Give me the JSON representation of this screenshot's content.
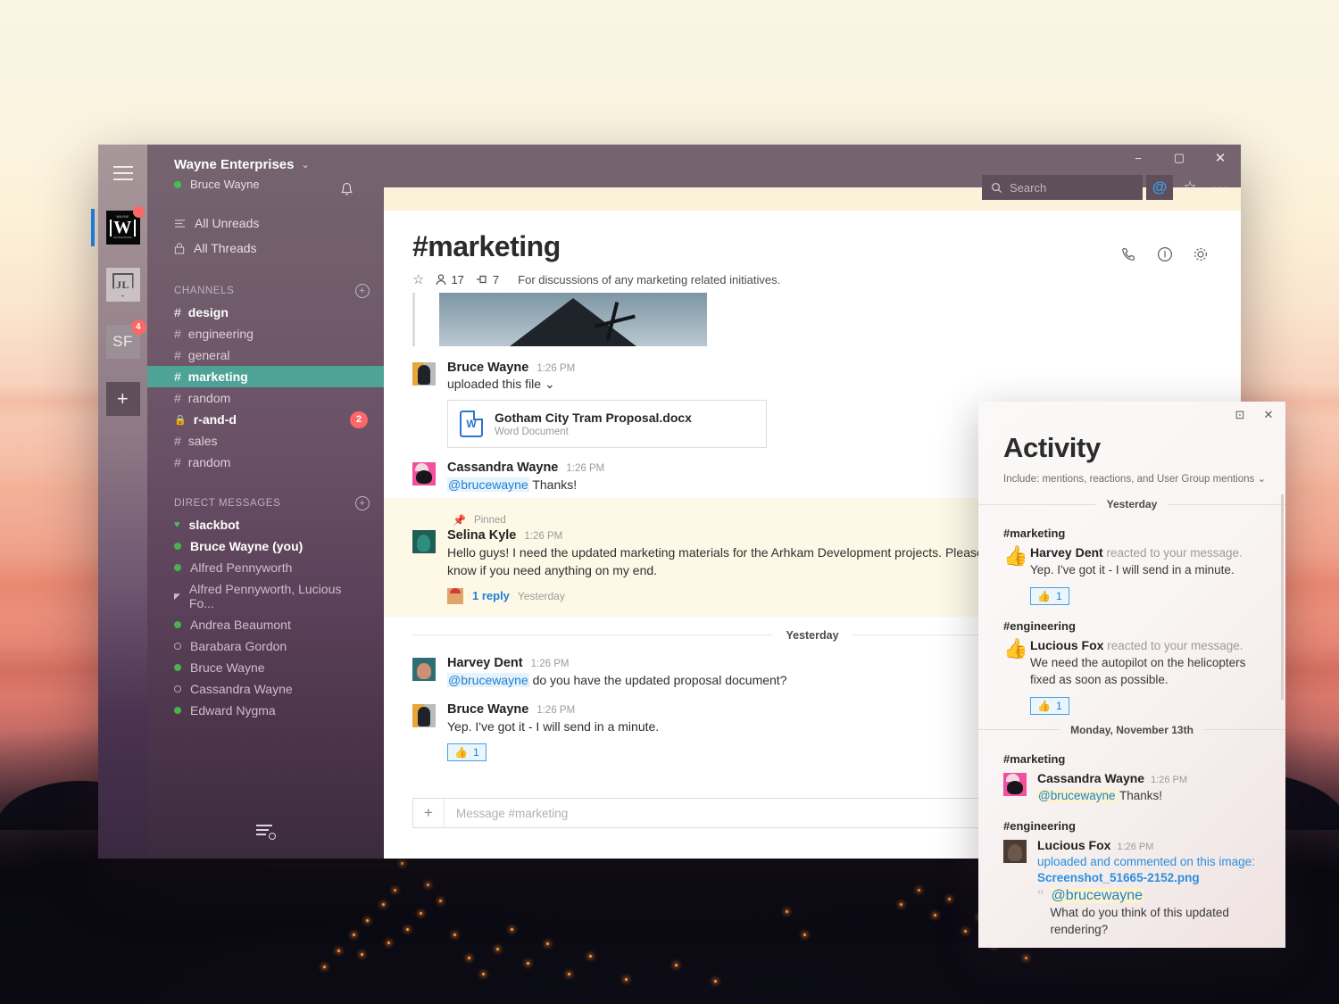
{
  "window": {
    "minimize": "−",
    "maximize": "▢",
    "close": "✕"
  },
  "rail": {
    "hamburger_icon": "hamburger-icon",
    "apps": [
      {
        "name": "Wayne Enterprises",
        "initials": "W",
        "logo_top": "WAYNE",
        "logo_bottom": "ENTERPRISES",
        "badge": "",
        "active": true
      },
      {
        "name": "Justice League",
        "initials": "JL",
        "badge": ""
      },
      {
        "name": "SF",
        "initials": "SF",
        "badge": "4"
      }
    ],
    "add_workspace_label": "+"
  },
  "topbar": {
    "search_placeholder": "Search",
    "search_value": "",
    "mentions_label": "@",
    "star_label": "☆",
    "more_label": "···"
  },
  "sidebar": {
    "team_name": "Wayne Enterprises",
    "team_chevron": "⌄",
    "user_name": "Bruce Wayne",
    "notifications_icon": "bell-icon",
    "nav": [
      {
        "label": "All Unreads",
        "icon": "unreads-icon"
      },
      {
        "label": "All Threads",
        "icon": "threads-icon"
      }
    ],
    "channels_header": "CHANNELS",
    "channels_add": "+",
    "channels": [
      {
        "name": "design",
        "prefix": "#",
        "bold": true,
        "active": false,
        "badge": ""
      },
      {
        "name": "engineering",
        "prefix": "#",
        "bold": false,
        "active": false,
        "badge": ""
      },
      {
        "name": "general",
        "prefix": "#",
        "bold": false,
        "active": false,
        "badge": ""
      },
      {
        "name": "marketing",
        "prefix": "#",
        "bold": true,
        "active": true,
        "badge": ""
      },
      {
        "name": "random",
        "prefix": "#",
        "bold": false,
        "active": false,
        "badge": ""
      },
      {
        "name": "r-and-d",
        "prefix": "🔒",
        "bold": true,
        "active": false,
        "badge": "2"
      },
      {
        "name": "sales",
        "prefix": "#",
        "bold": false,
        "active": false,
        "badge": ""
      },
      {
        "name": "random",
        "prefix": "#",
        "bold": false,
        "active": false,
        "badge": ""
      }
    ],
    "dms_header": "DIRECT MESSAGES",
    "dms_add": "+",
    "dms": [
      {
        "name": "slackbot",
        "status": "heart",
        "bright": true
      },
      {
        "name": "Bruce Wayne (you)",
        "status": "on",
        "bright": true
      },
      {
        "name": "Alfred Pennyworth",
        "status": "on",
        "bright": false
      },
      {
        "name": "Alfred Pennyworth, Lucious Fo...",
        "status": "group",
        "bright": false
      },
      {
        "name": "Andrea Beaumont",
        "status": "on",
        "bright": false
      },
      {
        "name": "Barabara Gordon",
        "status": "off",
        "bright": false
      },
      {
        "name": "Bruce Wayne",
        "status": "on",
        "bright": false
      },
      {
        "name": "Cassandra Wayne",
        "status": "off",
        "bright": false
      },
      {
        "name": "Edward Nygma",
        "status": "on",
        "bright": false
      }
    ],
    "filter_icon": "filter-search-icon"
  },
  "channel": {
    "title": "#marketing",
    "star_icon": "star-icon",
    "members_icon": "members-icon",
    "members_count": "17",
    "pins_icon": "pins-icon",
    "pins_count": "7",
    "topic": "For discussions of any marketing related initiatives.",
    "actions": {
      "call": "call-icon",
      "info": "info-icon",
      "settings": "gear-icon"
    },
    "composer_placeholder": "Message #marketing",
    "composer_value": "",
    "composer_plus": "+"
  },
  "messages": [
    {
      "type": "image",
      "author": "",
      "caption": ""
    },
    {
      "type": "file",
      "author": "Bruce Wayne",
      "time": "1:26 PM",
      "sub": "uploaded this file",
      "sub_chevron": "⌄",
      "file_name": "Gotham City Tram Proposal.docx",
      "file_type": "Word Document",
      "file_icon": "word-icon"
    },
    {
      "type": "text",
      "author": "Cassandra Wayne",
      "time": "1:26 PM",
      "mention": "@brucewayne",
      "text": " Thanks!"
    },
    {
      "type": "pinned",
      "pinned_label": "Pinned",
      "author": "Selina Kyle",
      "time": "1:26 PM",
      "text": "Hello guys! I need the updated marketing materials for the Arhkam Development projects. Please update or add your materials and let me know if you need anything on my end.",
      "thread_label": "1 reply",
      "thread_time": "Yesterday"
    },
    {
      "type": "divider",
      "label": "Yesterday"
    },
    {
      "type": "text",
      "author": "Harvey Dent",
      "time": "1:26 PM",
      "mention": "@brucewayne",
      "text": " do you have the updated proposal document?"
    },
    {
      "type": "text-reaction",
      "author": "Bruce Wayne",
      "time": "1:26 PM",
      "text": "Yep. I've got it - I will send in a minute.",
      "reaction_emoji": "👍",
      "reaction_count": "1"
    }
  ],
  "activity": {
    "title": "Activity",
    "subtitle": "Include: mentions, reactions, and User Group mentions",
    "subtitle_chevron": "⌄",
    "popout": "⊡",
    "close": "✕",
    "sections": [
      {
        "date": "Yesterday",
        "groups": [
          {
            "channel": "#marketing",
            "items": [
              {
                "kind": "reaction",
                "emoji": "👍",
                "name": "Harvey Dent",
                "verb": "reacted to your message.",
                "text": "Yep. I've got it - I will send in a minute.",
                "reaction_emoji": "👍",
                "reaction_count": "1"
              }
            ]
          },
          {
            "channel": "#engineering",
            "items": [
              {
                "kind": "reaction",
                "emoji": "👍",
                "name": "Lucious Fox",
                "verb": "reacted to your message.",
                "text": "We need the autopilot on the helicopters fixed as soon as possible.",
                "reaction_emoji": "👍",
                "reaction_count": "1"
              }
            ]
          }
        ]
      },
      {
        "date": "Monday, November 13th",
        "groups": [
          {
            "channel": "#marketing",
            "items": [
              {
                "kind": "mention",
                "avatar": "cassandra",
                "name": "Cassandra Wayne",
                "time": "1:26 PM",
                "mention": "@brucewayne",
                "text": " Thanks!"
              }
            ]
          },
          {
            "channel": "#engineering",
            "items": [
              {
                "kind": "upload",
                "avatar": "lucious",
                "name": "Lucious Fox",
                "time": "1:26 PM",
                "link_text": "uploaded and commented on this image:",
                "file_link": "Screenshot_51665-2152.png",
                "quote_mention": "@brucewayne",
                "quote_text": "What do you think of this updated rendering?"
              }
            ]
          }
        ]
      }
    ]
  },
  "colors": {
    "sidebar_top": "#75646f",
    "active_channel": "#4fa396",
    "badge_red": "#fc6767",
    "link_blue": "#1d7fd4",
    "presence_green": "#40c057"
  }
}
